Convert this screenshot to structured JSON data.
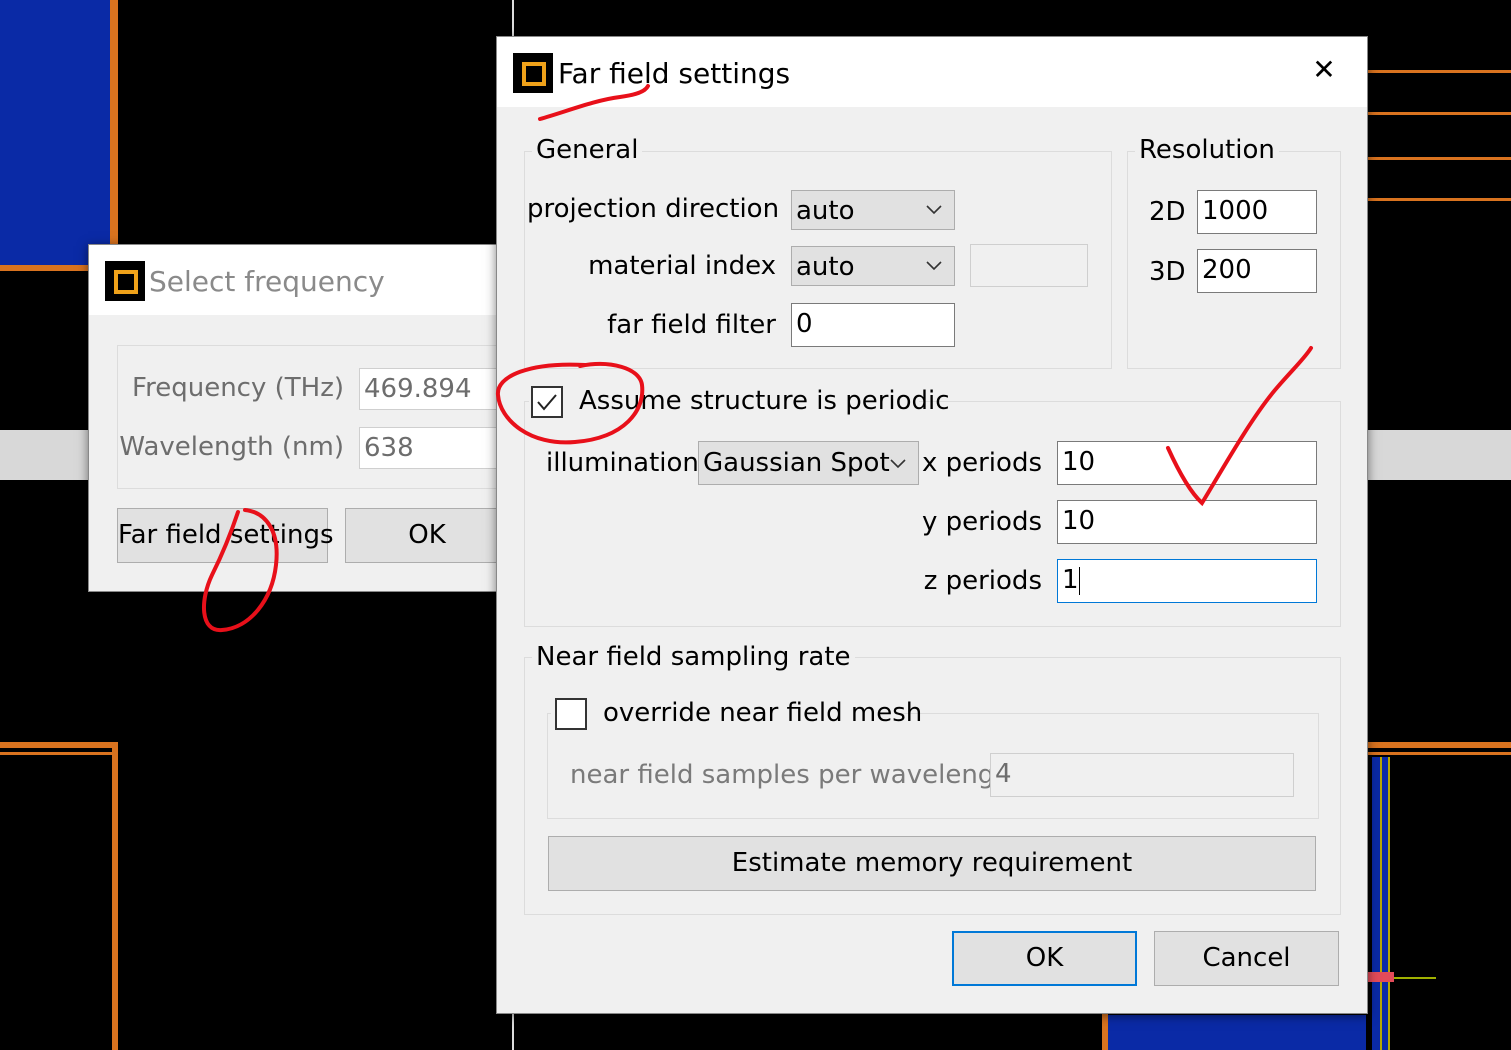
{
  "select_frequency_dialog": {
    "title": "Select frequency",
    "frequency_label": "Frequency (THz)",
    "frequency_value": "469.894",
    "wavelength_label": "Wavelength (nm)",
    "wavelength_value": "638",
    "far_field_button": "Far field settings",
    "ok_button": "OK"
  },
  "far_field_dialog": {
    "title": "Far field settings",
    "close_glyph": "✕",
    "general": {
      "group_label": "General",
      "projection_direction_label": "projection direction",
      "projection_direction_value": "auto",
      "material_index_label": "material index",
      "material_index_value": "auto",
      "material_index_extra": "",
      "far_field_filter_label": "far field filter",
      "far_field_filter_value": "0"
    },
    "resolution": {
      "group_label": "Resolution",
      "label_2d": "2D",
      "value_2d": "1000",
      "label_3d": "3D",
      "value_3d": "200"
    },
    "periodic": {
      "checkbox_label": "Assume structure is periodic",
      "checked": true,
      "illumination_label": "illumination",
      "illumination_value": "Gaussian Spot",
      "x_periods_label": "x periods",
      "x_periods_value": "10",
      "y_periods_label": "y periods",
      "y_periods_value": "10",
      "z_periods_label": "z periods",
      "z_periods_value": "1"
    },
    "near_field": {
      "group_label": "Near field sampling rate",
      "override_label": "override near field mesh",
      "override_checked": false,
      "samples_label": "near field samples per wavelength",
      "samples_value": "4"
    },
    "estimate_button": "Estimate memory requirement",
    "ok_button": "OK",
    "cancel_button": "Cancel"
  },
  "colors": {
    "annotation": "#e8101a",
    "app_icon_accent": "#f0a21a",
    "focus_blue": "#0078d7",
    "background_blue": "#0a2aa6",
    "background_orange": "#d9731f"
  }
}
